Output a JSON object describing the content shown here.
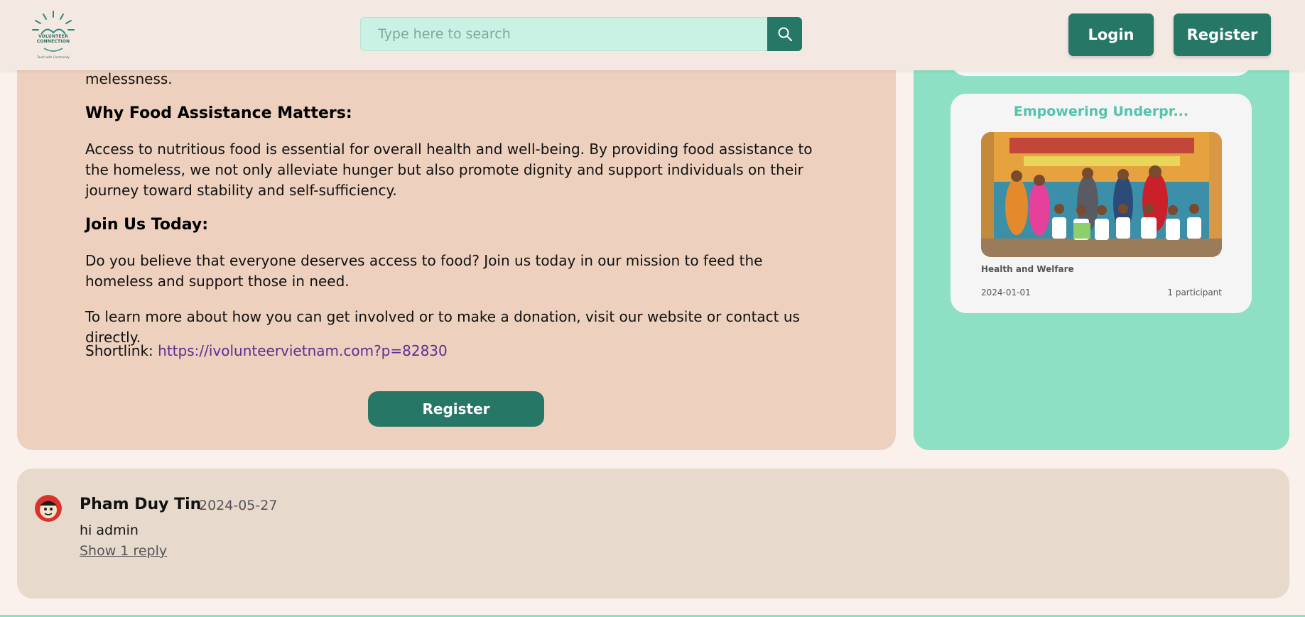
{
  "header": {
    "logo_text": "VOLUNTEER CONNECTION",
    "logo_sub": "Touch with Community",
    "search_placeholder": "Type here to search",
    "login_label": "Login",
    "register_label": "Register"
  },
  "article": {
    "intro_tail": "melessness.",
    "heading_why": "Why Food Assistance Matters:",
    "para_why": "Access to nutritious food is essential for overall health and well-being. By providing food assistance to the homeless, we not only alleviate hunger but also promote dignity and support individuals on their journey toward stability and self-sufficiency.",
    "heading_join": "Join Us Today:",
    "para_join": "Do you believe that everyone deserves access to food? Join us today in our mission to feed the homeless and support those in need.",
    "para_learn": "To learn more about how you can get involved or to make a donation, visit our website or contact us directly.",
    "shortlink_label": "Shortlink:",
    "shortlink_url": "https://ivolunteervietnam.com?p=82830",
    "register_label": "Register"
  },
  "sidebar": {
    "card": {
      "title": "Empowering Underpr...",
      "category": "Health and Welfare",
      "date": "2024-01-01",
      "participants": "1 participant"
    }
  },
  "comments": [
    {
      "author": "Pham Duy Tin",
      "date": "2024-05-27",
      "text": "hi admin",
      "reply_label": "Show 1 reply"
    }
  ],
  "icons": {
    "search": "search-icon",
    "logo": "logo-icon",
    "avatar": "avatar"
  },
  "colors": {
    "primary": "#277766",
    "article_bg": "#edd0bd",
    "sidebar_bg": "#8ee0c4",
    "card_title": "#52c3ad",
    "link": "#5b2f91"
  }
}
